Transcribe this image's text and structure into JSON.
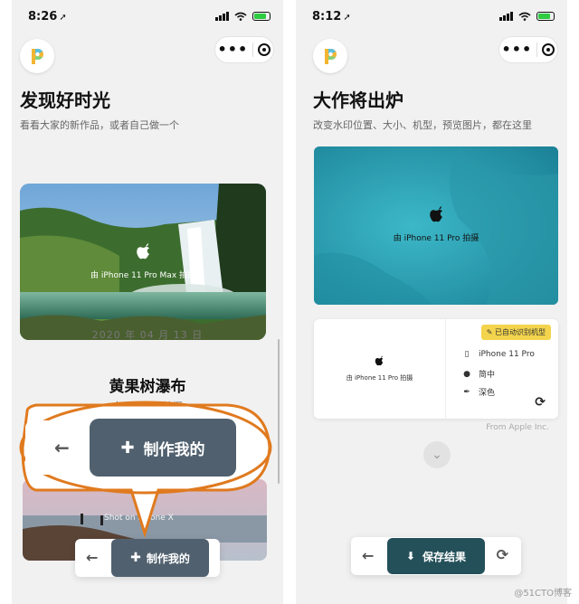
{
  "left": {
    "status_time": "8:26",
    "title": "发现好时光",
    "subtitle": "看看大家的新作品，或者自己做一个",
    "card_watermark": "由 iPhone 11 Pro Max 拍摄",
    "date": "2020 年 04 月 13 日",
    "place": "黄果树瀑布",
    "sub_peek": "由 iPh...  ...拍摄",
    "second_card_watermark": "Shot on iPhone X",
    "make_label": "制作我的",
    "zoom_make_label": "制作我的"
  },
  "right": {
    "status_time": "8:12",
    "title": "大作将出炉",
    "subtitle": "改变水印位置、大小、机型，预览图片，都在这里",
    "card_watermark": "由 iPhone 11 Pro 拍摄",
    "preview_watermark": "由 iPhone 11 Pro 拍摄",
    "auto_badge": "已自动识别机型",
    "options": [
      {
        "icon": "phone-icon",
        "label": "iPhone 11 Pro"
      },
      {
        "icon": "globe-icon",
        "label": "简中"
      },
      {
        "icon": "brush-icon",
        "label": "深色"
      }
    ],
    "credit": "From Apple Inc.",
    "save_label": "保存结果"
  },
  "footer_watermark": "@51CTO博客",
  "colors": {
    "make_button": "#50606e",
    "save_button": "#24505a",
    "callout_orange": "#e07a1f",
    "badge_yellow": "#f3d44c"
  }
}
